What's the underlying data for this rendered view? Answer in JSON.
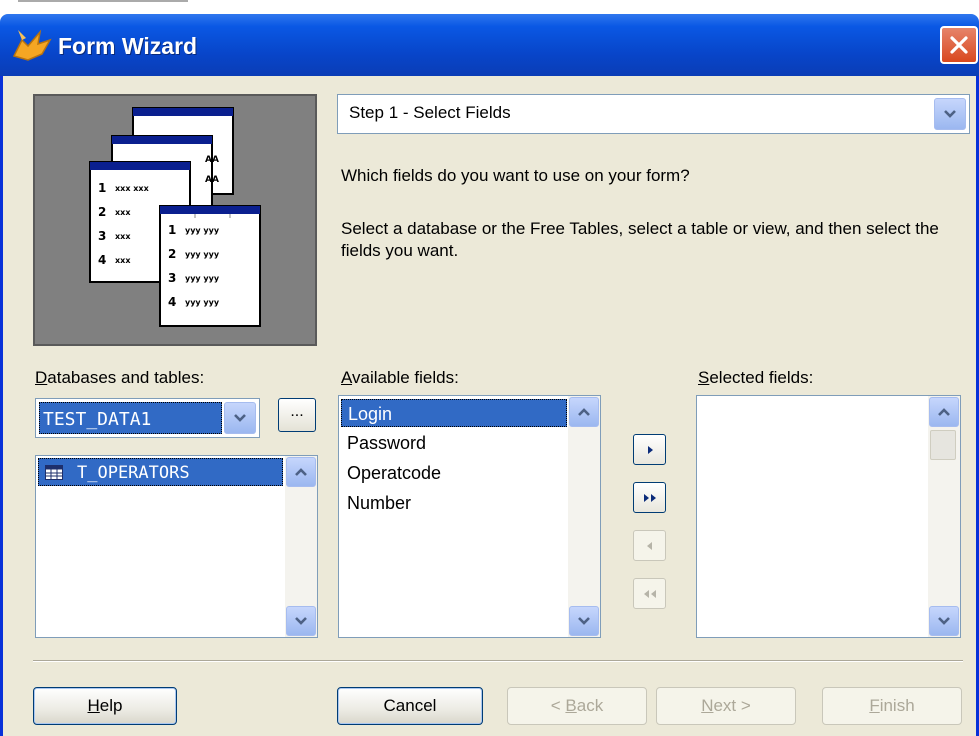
{
  "window": {
    "title": "Form Wizard"
  },
  "step": {
    "value": "Step 1 - Select Fields"
  },
  "instructions": {
    "question": "Which fields do you want to use on your form?",
    "detail": "Select a database or the Free Tables, select a table or view, and then select the fields you want."
  },
  "databases": {
    "label_accel": "D",
    "label_rest": "atabases and tables:",
    "selected_db": "TEST_DATA1",
    "browse_label": "...",
    "tables": [
      "T_OPERATORS"
    ]
  },
  "available": {
    "label_accel": "A",
    "label_rest": "vailable fields:",
    "fields": [
      "Login",
      "Password",
      "Operatcode",
      "Number"
    ]
  },
  "selected": {
    "label_accel": "S",
    "label_rest": "elected fields:",
    "fields": []
  },
  "buttons": {
    "help_accel": "H",
    "help_rest": "elp",
    "cancel": "Cancel",
    "back_prefix": "< ",
    "back_accel": "B",
    "back_rest": "ack",
    "next_accel": "N",
    "next_rest": "ext >",
    "finish_accel": "F",
    "finish_rest": "inish"
  },
  "colors": {
    "title_blue": "#0a58e4",
    "selection": "#316ac5",
    "dialog_bg": "#ece9d8"
  }
}
